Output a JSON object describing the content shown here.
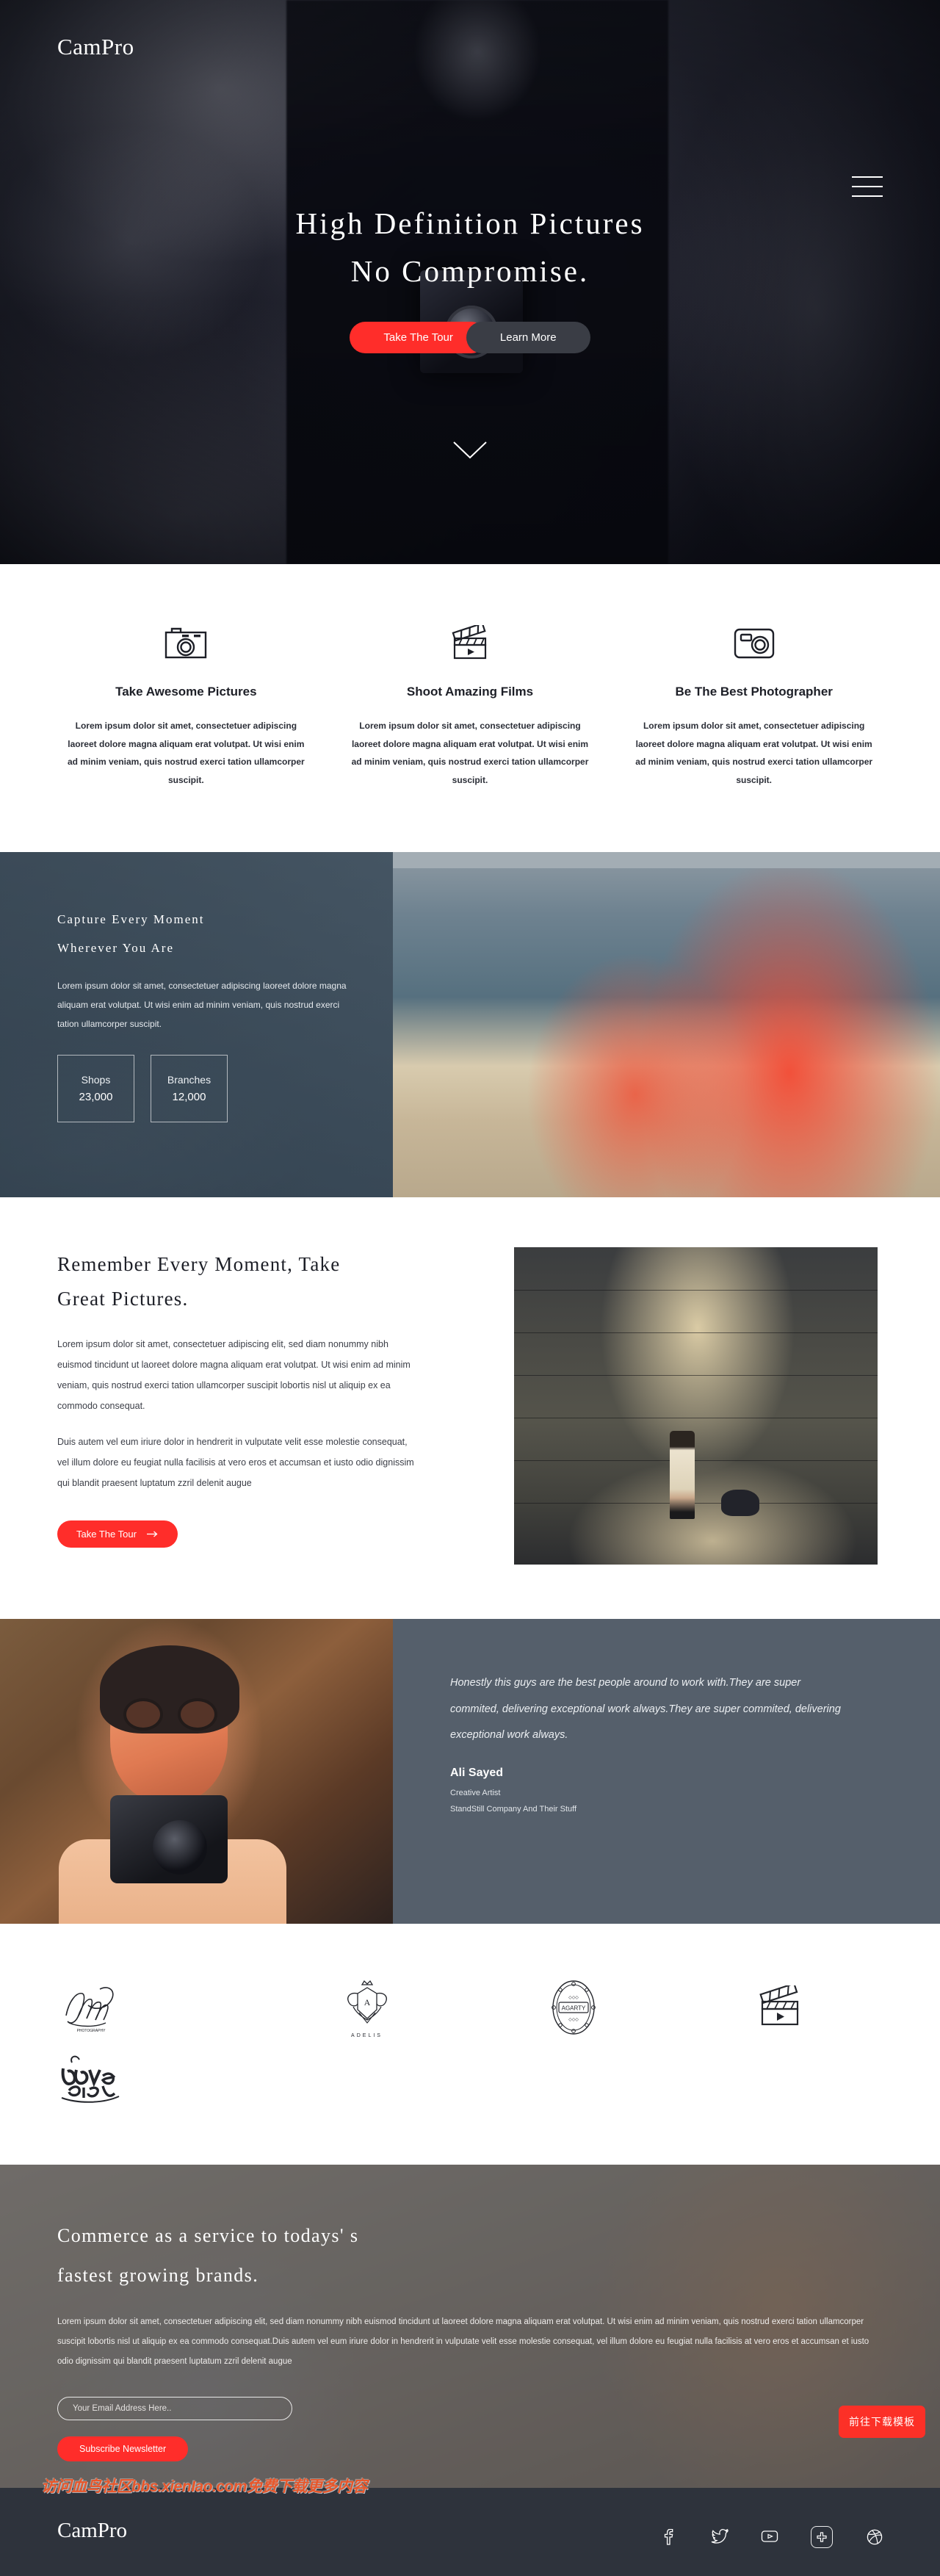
{
  "brand": {
    "name": "CamPro"
  },
  "colors": {
    "accent": "#FF2D2A",
    "dark_btn": "#3a3d45",
    "testimonial_bg": "#555F6B",
    "footer_bg": "#2E333C",
    "watermark": "#E8572B"
  },
  "hero": {
    "title_line1": "High Definition Pictures",
    "title_line2": "No Compromise.",
    "primary_button": "Take The Tour",
    "secondary_button": "Learn More",
    "menu_icon": "hamburger-icon",
    "scroll_icon": "chevron-down-icon"
  },
  "features": [
    {
      "icon": "camera-retro-icon",
      "title": "Take Awesome Pictures",
      "text": "Lorem ipsum dolor sit amet, consectetuer adipiscing laoreet dolore magna aliquam erat volutpat. Ut wisi enim ad minim veniam, quis nostrud exerci tation ullamcorper suscipit."
    },
    {
      "icon": "clapperboard-icon",
      "title": "Shoot Amazing Films",
      "text": "Lorem ipsum dolor sit amet, consectetuer adipiscing laoreet dolore magna aliquam erat volutpat. Ut wisi enim ad minim veniam, quis nostrud exerci tation ullamcorper suscipit."
    },
    {
      "icon": "compact-camera-icon",
      "title": "Be The Best Photographer",
      "text": "Lorem ipsum dolor sit amet, consectetuer adipiscing laoreet dolore magna aliquam erat volutpat. Ut wisi enim ad minim veniam, quis nostrud exerci tation ullamcorper suscipit."
    }
  ],
  "capture": {
    "heading_line1": "Capture Every Moment",
    "heading_line2": "Wherever You Are",
    "text": "Lorem ipsum dolor sit amet, consectetuer adipiscing laoreet dolore magna aliquam erat volutpat. Ut wisi enim ad minim veniam, quis nostrud exerci tation ullamcorper suscipit.",
    "stats": [
      {
        "label": "Shops",
        "value": "23,000"
      },
      {
        "label": "Branches",
        "value": "12,000"
      }
    ]
  },
  "remember": {
    "heading_line1": "Remember Every Moment, Take",
    "heading_line2": "Great Pictures.",
    "paragraph1": "Lorem ipsum dolor sit amet, consectetuer adipiscing elit, sed diam nonummy nibh euismod tincidunt ut laoreet dolore magna aliquam erat volutpat. Ut wisi enim ad minim veniam, quis nostrud exerci tation ullamcorper suscipit lobortis nisl ut aliquip ex ea commodo consequat.",
    "paragraph2": "Duis autem vel eum iriure dolor in hendrerit in vulputate velit esse molestie consequat, vel illum dolore eu feugiat nulla facilisis at vero eros et accumsan et iusto odio dignissim qui blandit praesent luptatum zzril delenit augue",
    "button": "Take The Tour",
    "button_icon": "arrow-right-icon"
  },
  "testimonial": {
    "quote": "Honestly this guys are the best people around to work with.They are super commited, delivering exceptional work always.They are super commited, delivering exceptional work always.",
    "name": "Ali Sayed",
    "role": "Creative Artist",
    "company": "StandStill Company And Their Stuff"
  },
  "brands": [
    {
      "icon": "azuam-script-logo",
      "label": ""
    },
    {
      "icon": "adelis-crest-logo",
      "label": "ADELIS"
    },
    {
      "icon": "agarty-badge-logo",
      "label": ""
    },
    {
      "icon": "clapperboard-logo",
      "label": ""
    },
    {
      "icon": "love-is-art-logo",
      "label": ""
    }
  ],
  "cta": {
    "heading_line1": "Commerce as a service to todays' s",
    "heading_line2": "fastest growing brands.",
    "text": "Lorem ipsum dolor sit amet, consectetuer adipiscing elit, sed diam nonummy nibh euismod tincidunt ut laoreet dolore magna aliquam erat volutpat. Ut wisi enim ad minim veniam, quis nostrud exerci tation ullamcorper suscipit lobortis nisl ut aliquip ex ea commodo consequat.Duis autem vel eum iriure dolor in hendrerit in vulputate velit esse molestie consequat, vel illum dolore eu feugiat nulla facilisis at vero eros et accumsan et iusto odio dignissim qui blandit praesent luptatum zzril delenit augue",
    "email_placeholder": "Your Email Address Here..",
    "subscribe_button": "Subscribe Newsletter"
  },
  "footer": {
    "logo": "CamPro",
    "socials": [
      "facebook-icon",
      "twitter-icon",
      "youtube-icon",
      "google-plus-icon",
      "dribbble-icon"
    ]
  },
  "overlay": {
    "watermark_text": "访问血鸟社区bbs.xienIao.com免费下载更多内容",
    "download_button": "前往下载模板"
  }
}
